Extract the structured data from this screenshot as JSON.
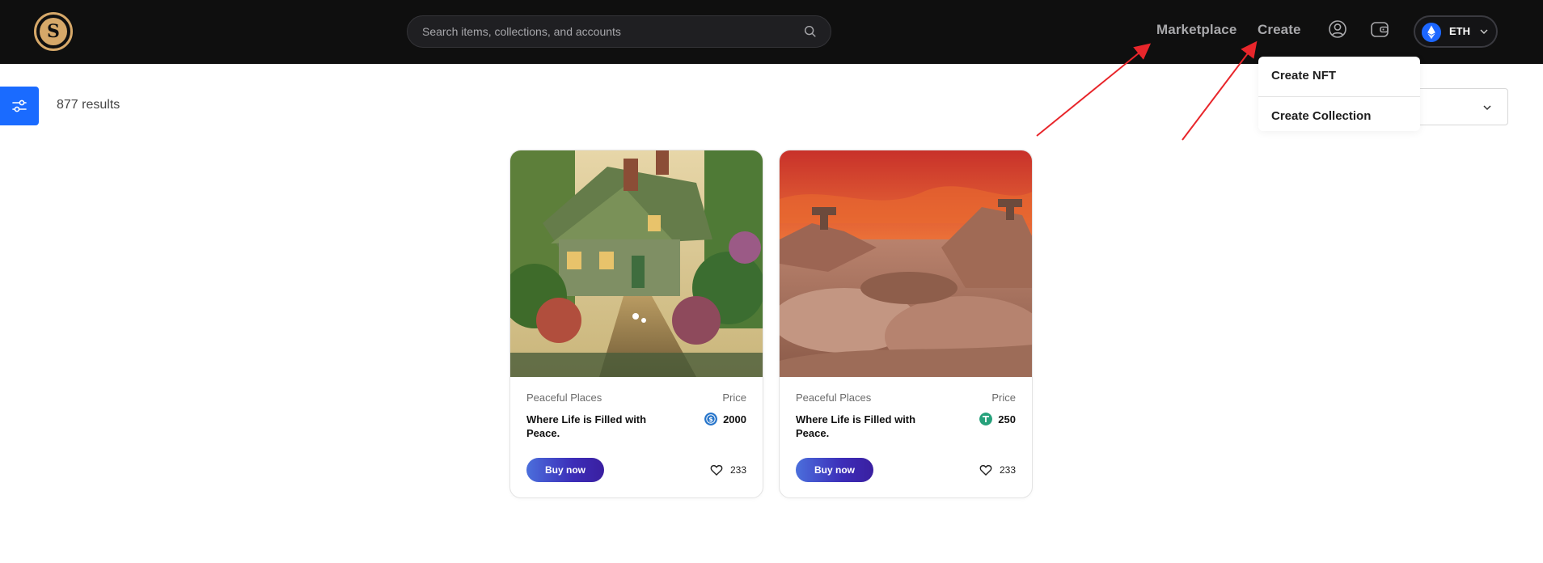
{
  "header": {
    "logo_label": "S",
    "search": {
      "placeholder": "Search items, collections, and accounts"
    },
    "nav": {
      "marketplace": "Marketplace",
      "create": "Create"
    },
    "network": {
      "label": "ETH"
    }
  },
  "create_menu": {
    "items": [
      {
        "label": "Create NFT"
      },
      {
        "label": "Create Collection"
      }
    ]
  },
  "filters": {
    "results_text": "877 results"
  },
  "cards": [
    {
      "collection": "Peaceful Places",
      "title": "Where Life is Filled with Peace.",
      "price_label": "Price",
      "price": "2000",
      "currency_icon": "usdc-coin-icon",
      "buy_label": "Buy now",
      "likes": "233"
    },
    {
      "collection": "Peaceful Places",
      "title": "Where Life is Filled with Peace.",
      "price_label": "Price",
      "price": "250",
      "currency_icon": "tether-coin-icon",
      "buy_label": "Buy now",
      "likes": "233"
    }
  ],
  "colors": {
    "header_bg": "#0f0f0f",
    "accent_blue": "#1a6bff",
    "buy_gradient_start": "#4b6fdc",
    "buy_gradient_end": "#3a1fa0",
    "annotation_arrow": "#e8262b"
  }
}
